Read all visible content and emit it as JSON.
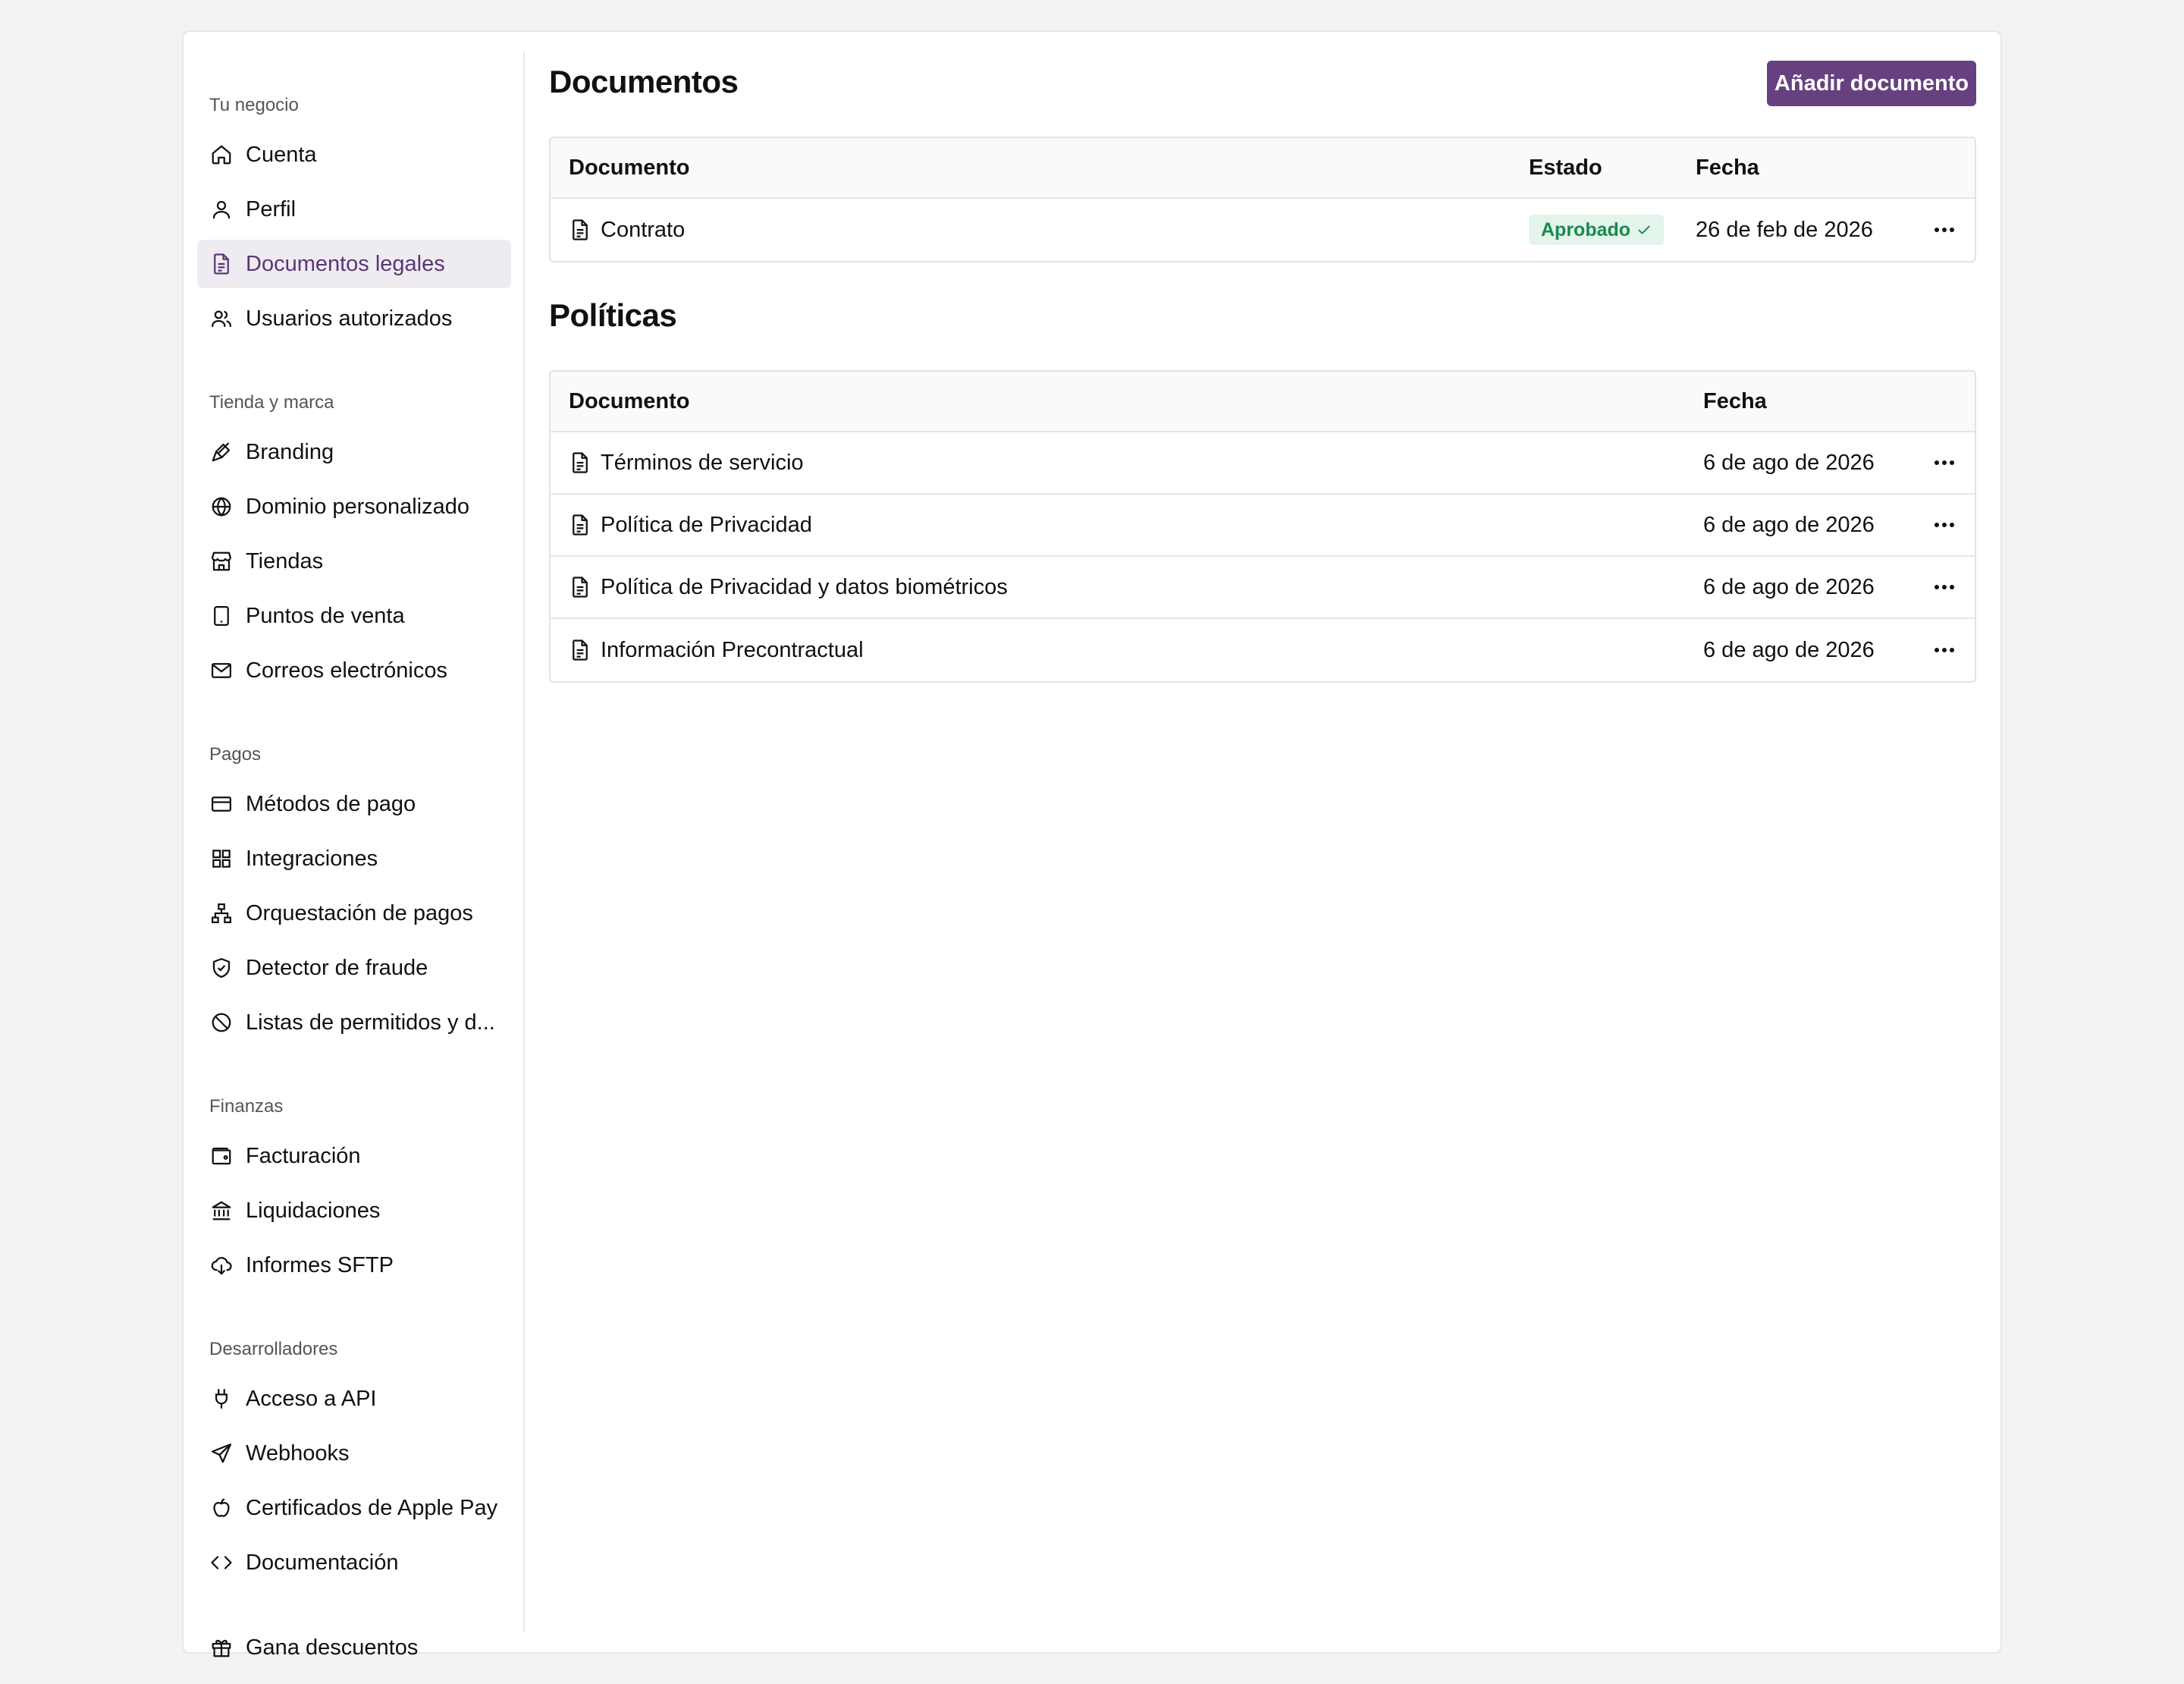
{
  "sidebar": {
    "sections": [
      {
        "title": "Tu negocio"
      },
      {
        "title": "Tienda y marca"
      },
      {
        "title": "Pagos"
      },
      {
        "title": "Finanzas"
      },
      {
        "title": "Desarrolladores"
      }
    ],
    "items": [
      {
        "label": "Cuenta",
        "icon": "home-icon"
      },
      {
        "label": "Perfil",
        "icon": "user-icon"
      },
      {
        "label": "Documentos legales",
        "icon": "document-icon",
        "active": true
      },
      {
        "label": "Usuarios autorizados",
        "icon": "users-icon"
      },
      {
        "label": "Branding",
        "icon": "paintbrush-icon"
      },
      {
        "label": "Dominio personalizado",
        "icon": "globe-icon"
      },
      {
        "label": "Tiendas",
        "icon": "store-icon"
      },
      {
        "label": "Puntos de venta",
        "icon": "tablet-icon"
      },
      {
        "label": "Correos electrónicos",
        "icon": "mail-icon"
      },
      {
        "label": "Métodos de pago",
        "icon": "credit-card-icon"
      },
      {
        "label": "Integraciones",
        "icon": "grid-icon"
      },
      {
        "label": "Orquestación de pagos",
        "icon": "network-icon"
      },
      {
        "label": "Detector de fraude",
        "icon": "shield-check-icon"
      },
      {
        "label": "Listas de permitidos y d...",
        "icon": "ban-icon"
      },
      {
        "label": "Facturación",
        "icon": "wallet-icon"
      },
      {
        "label": "Liquidaciones",
        "icon": "bank-icon"
      },
      {
        "label": "Informes SFTP",
        "icon": "cloud-download-icon"
      },
      {
        "label": "Acceso a API",
        "icon": "plug-icon"
      },
      {
        "label": "Webhooks",
        "icon": "send-icon"
      },
      {
        "label": "Certificados de Apple Pay",
        "icon": "apple-icon"
      },
      {
        "label": "Documentación",
        "icon": "code-icon"
      },
      {
        "label": "Gana descuentos",
        "icon": "gift-icon"
      }
    ]
  },
  "main": {
    "documents": {
      "title": "Documentos",
      "add_button": "Añadir documento",
      "columns": {
        "document": "Documento",
        "status": "Estado",
        "date": "Fecha"
      },
      "rows": [
        {
          "name": "Contrato",
          "status": "Aprobado",
          "date": "26 de feb de 2026"
        }
      ]
    },
    "policies": {
      "title": "Políticas",
      "columns": {
        "document": "Documento",
        "date": "Fecha"
      },
      "rows": [
        {
          "name": "Términos de servicio",
          "date": "6 de ago de 2026"
        },
        {
          "name": "Política de Privacidad",
          "date": "6 de ago de 2026"
        },
        {
          "name": "Política de Privacidad y datos biométricos",
          "date": "6 de ago de 2026"
        },
        {
          "name": "Información Precontractual",
          "date": "6 de ago de 2026"
        }
      ]
    }
  },
  "colors": {
    "accent": "#67417f",
    "active_bg": "#efecf1",
    "badge_bg": "#e3f4ea",
    "badge_text": "#198a4d"
  }
}
